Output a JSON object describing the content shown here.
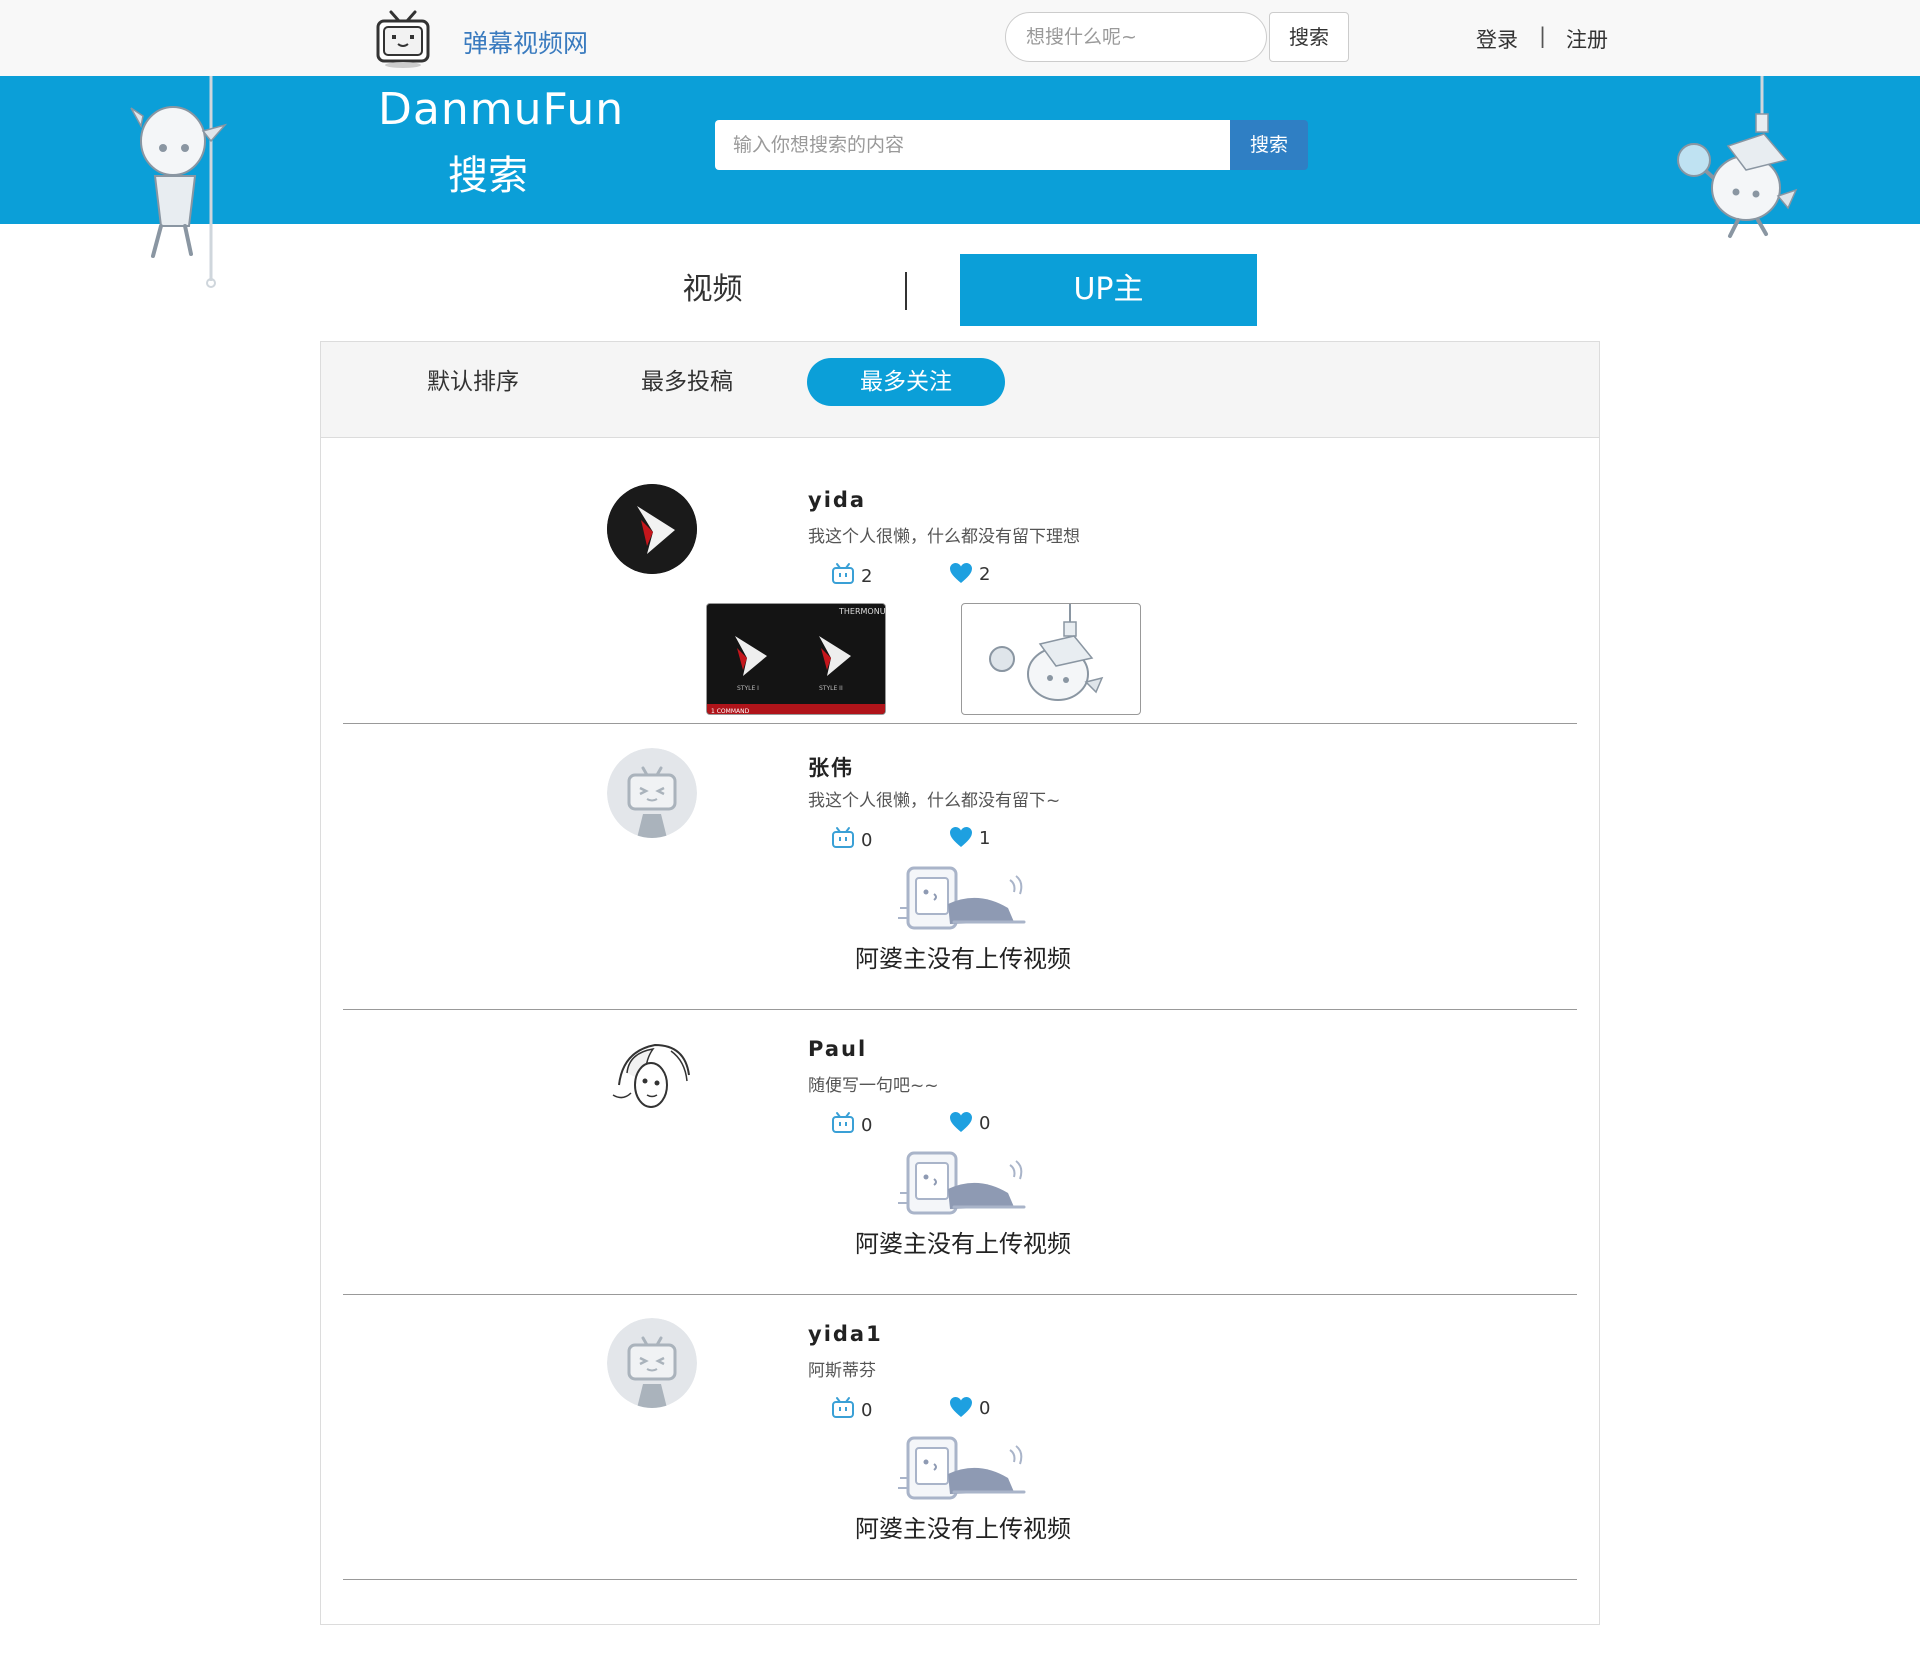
{
  "topnav": {
    "site_name": "弹幕视频网",
    "search_placeholder": "想搜什么呢~",
    "search_button": "搜索",
    "login": "登录",
    "separator": "|",
    "register": "注册"
  },
  "banner": {
    "title": "DanmuFun",
    "subtitle": "搜索",
    "search_placeholder": "输入你想搜索的内容",
    "search_button": "搜索"
  },
  "tabs": {
    "video": "视频",
    "up": "UP主",
    "active": "UP主"
  },
  "sort": {
    "default": "默认排序",
    "most_posts": "最多投稿",
    "most_follows": "最多关注",
    "active": "最多关注"
  },
  "users": [
    {
      "name": "yida",
      "signature": "我这个人很懒，什么都没有留下理想",
      "videos": "2",
      "likes": "2"
    },
    {
      "name": "张伟",
      "signature": "我这个人很懒，什么都没有留下~",
      "videos": "0",
      "likes": "1",
      "empty": "阿婆主没有上传视频"
    },
    {
      "name": "Paul",
      "signature": "随便写一句吧~~",
      "videos": "0",
      "likes": "0",
      "empty": "阿婆主没有上传视频"
    },
    {
      "name": "yida1",
      "signature": "阿斯蒂芬",
      "videos": "0",
      "likes": "0",
      "empty": "阿婆主没有上传视频"
    }
  ],
  "thumb_text": {
    "brand": "THERMONUKE",
    "style1": "STYLE I",
    "style2": "STYLE II",
    "footer": "1 COMMAND"
  },
  "colors": {
    "accent": "#0b9fd8",
    "button_blue": "#2f7fc4",
    "site_name": "#3a7bbf",
    "top_bg": "#f8f8f8",
    "panel_bg": "#f5f5f5"
  },
  "icons": {
    "logo": "tv-logo-icon",
    "video_count": "tv-small-icon",
    "like_count": "heart-icon"
  }
}
